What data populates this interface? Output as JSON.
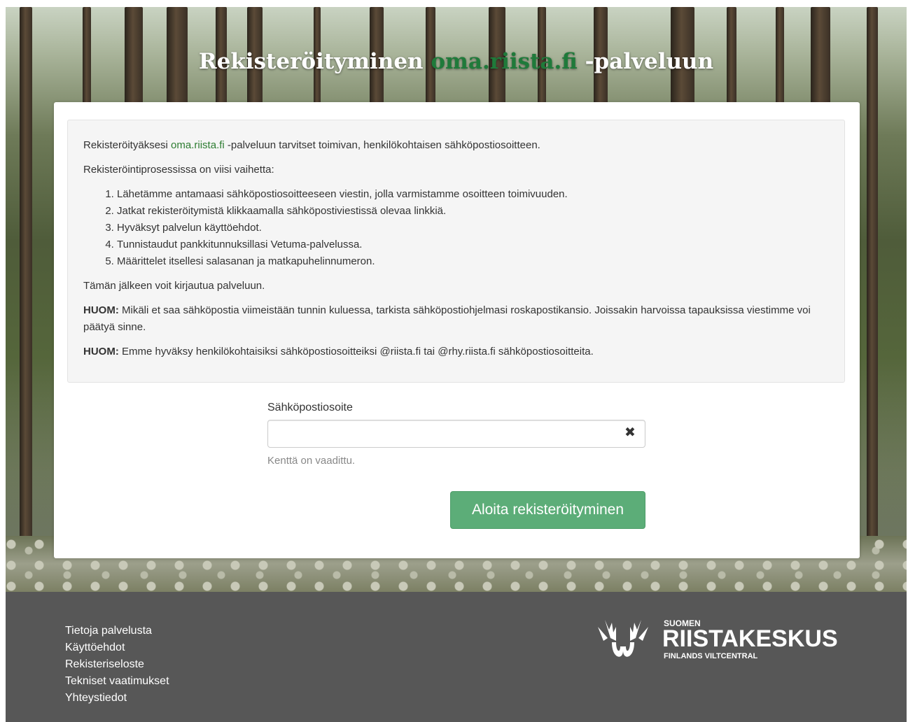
{
  "hero": {
    "title_before": "Rekisteröityminen ",
    "title_accent": "oma.riista.fi",
    "title_after": " -palveluun"
  },
  "info": {
    "intro_before": "Rekisteröityäksesi ",
    "intro_link": "oma.riista.fi",
    "intro_after": " -palveluun tarvitset toimivan, henkilökohtaisen sähköpostiosoitteen.",
    "steps_intro": "Rekisteröintiprosessissa on viisi vaihetta:",
    "steps": [
      "Lähetämme antamaasi sähköpostiosoitteeseen viestin, jolla varmistamme osoitteen toimivuuden.",
      "Jatkat rekisteröitymistä klikkaamalla sähköpostiviestissä olevaa linkkiä.",
      "Hyväksyt palvelun käyttöehdot.",
      "Tunnistaudut pankkitunnuksillasi Vetuma-palvelussa.",
      "Määrittelet itsellesi salasanan ja matkapuhelinnumeron."
    ],
    "after_steps": "Tämän jälkeen voit kirjautua palveluun.",
    "note1_label": "HUOM:",
    "note1_text": " Mikäli et saa sähköpostia viimeistään tunnin kuluessa, tarkista sähköpostiohjelmasi roskapostikansio. Joissakin harvoissa tapauksissa viestimme voi päätyä sinne.",
    "note2_label": "HUOM:",
    "note2_text": " Emme hyväksy henkilökohtaisiksi sähköpostiosoitteiksi @riista.fi tai @rhy.riista.fi sähköpostiosoitteita."
  },
  "form": {
    "email_label": "Sähköpostiosoite",
    "email_value": "",
    "clear_glyph": "✖",
    "help_text": "Kenttä on vaadittu.",
    "submit_label": "Aloita rekisteröityminen"
  },
  "footer": {
    "links": [
      "Tietoja palvelusta",
      "Käyttöehdot",
      "Rekisteriseloste",
      "Tekniset vaatimukset",
      "Yhteystiedot"
    ],
    "logo": {
      "top": "SUOMEN",
      "main": "RIISTAKESKUS",
      "sub": "FINLANDS VILTCENTRAL",
      "icon": "antler-emblem-icon"
    }
  },
  "colors": {
    "accent_green": "#1f7a3a",
    "link_green": "#2e7d32",
    "button_green": "#5cad78",
    "footer_bg": "#575757"
  }
}
